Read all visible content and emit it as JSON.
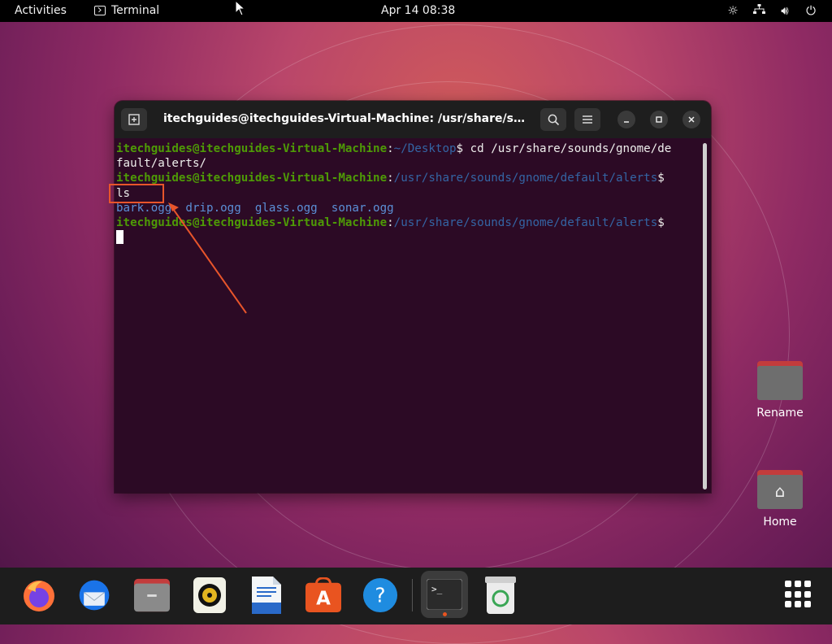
{
  "topbar": {
    "activities": "Activities",
    "app_name": "Terminal",
    "clock": "Apr 14  08:38",
    "tray_icons": [
      "brightness-icon",
      "network-icon",
      "volume-icon",
      "power-icon"
    ]
  },
  "terminal": {
    "title": "itechguides@itechguides-Virtual-Machine: /usr/share/sound...",
    "lines": [
      {
        "user": "itechguides@itechguides-Virtual-Machine",
        "sep": ":",
        "path": "~/Desktop",
        "prompt": "$",
        "cmd": " cd /usr/share/sounds/gnome/de"
      },
      {
        "text": "fault/alerts/"
      },
      {
        "user": "itechguides@itechguides-Virtual-Machine",
        "sep": ":",
        "path": "/usr/share/sounds/gnome/default/alerts",
        "prompt": "$"
      },
      {
        "text": "ls"
      },
      {
        "files": "bark.ogg  drip.ogg  glass.ogg  sonar.ogg"
      },
      {
        "user": "itechguides@itechguides-Virtual-Machine",
        "sep": ":",
        "path": "/usr/share/sounds/gnome/default/alerts",
        "prompt": "$"
      }
    ]
  },
  "desktop": {
    "icons": [
      {
        "label": "Rename"
      },
      {
        "label": "Home"
      }
    ]
  },
  "dock": {
    "apps": [
      "firefox-icon",
      "thunderbird-icon",
      "files-icon",
      "rhythmbox-icon",
      "libreoffice-writer-icon",
      "software-icon",
      "help-icon",
      "terminal-icon",
      "trash-icon"
    ],
    "active": "terminal-icon",
    "apps_grid": "show-applications-icon"
  },
  "colors": {
    "accent": "#e95420",
    "prompt_user": "#4e9a06",
    "prompt_path": "#3465a4",
    "terminal_bg": "#2c0a25",
    "annotation": "#e8552b"
  }
}
